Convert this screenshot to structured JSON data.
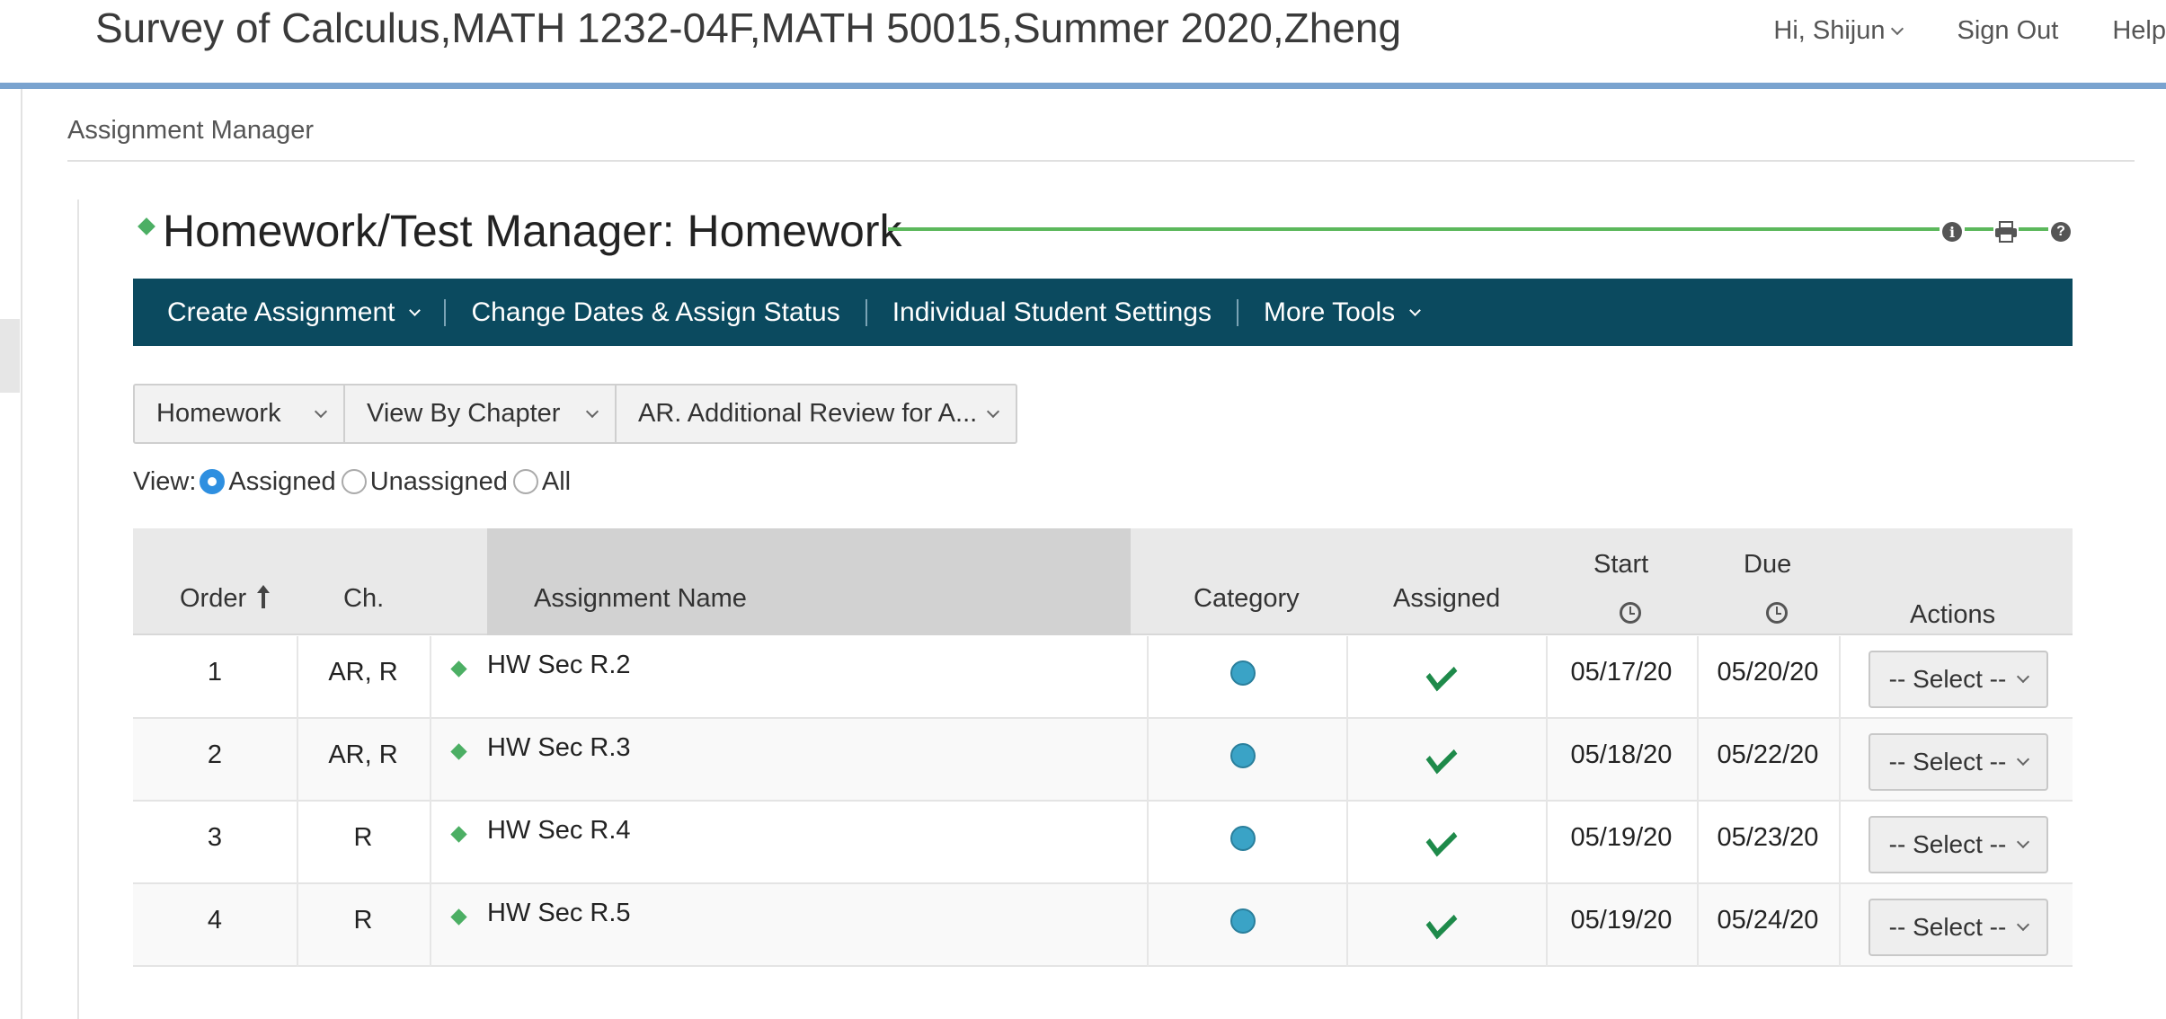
{
  "header": {
    "course_title": "Survey of Calculus,MATH 1232-04F,MATH 50015,Summer 2020,Zheng",
    "greeting": "Hi, Shijun",
    "sign_out": "Sign Out",
    "help": "Help"
  },
  "breadcrumb": "Assignment Manager",
  "page_title": "Homework/Test Manager: Homework",
  "title_icons": [
    "info-icon",
    "print-icon",
    "help-icon"
  ],
  "toolbar": {
    "create_assignment": "Create Assignment",
    "change_dates": "Change Dates & Assign Status",
    "individual_settings": "Individual Student Settings",
    "more_tools": "More Tools"
  },
  "filters": {
    "type": "Homework",
    "view_by": "View By Chapter",
    "chapter": "AR. Additional Review for A..."
  },
  "view": {
    "label": "View:",
    "options": [
      "Assigned",
      "Unassigned",
      "All"
    ],
    "selected": "Assigned"
  },
  "table": {
    "headers": {
      "order": "Order",
      "ch": "Ch.",
      "name": "Assignment Name",
      "category": "Category",
      "assigned": "Assigned",
      "start": "Start",
      "due": "Due",
      "actions": "Actions"
    },
    "rows": [
      {
        "order": "1",
        "ch": "AR, R",
        "name": "HW Sec R.2",
        "start": "05/17/20",
        "due": "05/20/20",
        "action": "-- Select --"
      },
      {
        "order": "2",
        "ch": "AR, R",
        "name": "HW Sec R.3",
        "start": "05/18/20",
        "due": "05/22/20",
        "action": "-- Select --"
      },
      {
        "order": "3",
        "ch": "R",
        "name": "HW Sec R.4",
        "start": "05/19/20",
        "due": "05/23/20",
        "action": "-- Select --"
      },
      {
        "order": "4",
        "ch": "R",
        "name": "HW Sec R.5",
        "start": "05/19/20",
        "due": "05/24/20",
        "action": "-- Select --"
      }
    ]
  },
  "colors": {
    "toolbar_bg": "#0b4a5f",
    "accent_green": "#4caf64",
    "header_rule": "#7aa3cf",
    "category_dot": "#3aa3c6",
    "check": "#1e8a4a"
  }
}
